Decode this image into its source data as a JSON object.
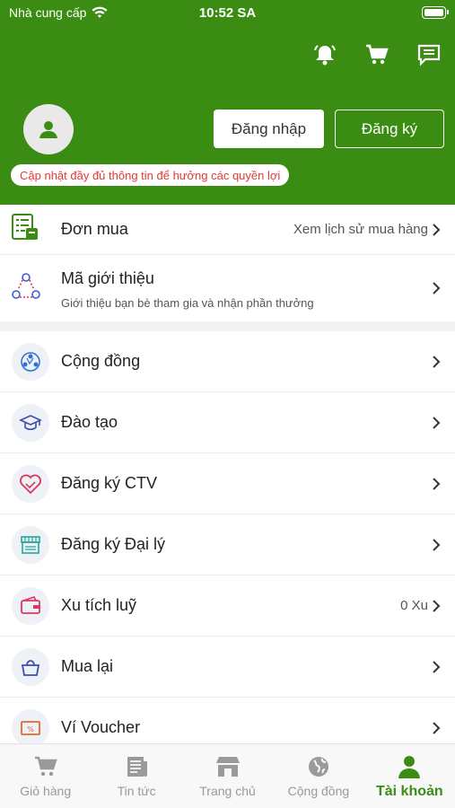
{
  "status_bar": {
    "carrier": "Nhà cung cấp",
    "time": "10:52 SA"
  },
  "header": {
    "login_label": "Đăng nhập",
    "register_label": "Đăng ký",
    "notice": "Cập nhật đầy đủ thông tin để hưởng các quyền lợi",
    "icons": [
      "bell-icon",
      "cart-icon",
      "message-icon"
    ]
  },
  "orders": {
    "label": "Đơn mua",
    "right_text": "Xem lịch sử mua hàng"
  },
  "referral": {
    "label": "Mã giới thiệu",
    "subtitle": "Giới thiệu bạn bè tham gia và nhận phần thưởng"
  },
  "menu": [
    {
      "label": "Cộng đồng",
      "right": "",
      "icon": "community-icon"
    },
    {
      "label": "Đào tạo",
      "right": "",
      "icon": "graduation-cap-icon"
    },
    {
      "label": "Đăng ký CTV",
      "right": "",
      "icon": "handshake-heart-icon"
    },
    {
      "label": "Đăng ký Đại lý",
      "right": "",
      "icon": "store-icon"
    },
    {
      "label": "Xu tích luỹ",
      "right": "0 Xu",
      "icon": "wallet-icon"
    },
    {
      "label": "Mua lại",
      "right": "",
      "icon": "bag-icon"
    },
    {
      "label": "Ví Voucher",
      "right": "",
      "icon": "voucher-icon"
    }
  ],
  "tabbar": [
    {
      "label": "Giỏ hàng",
      "icon": "cart-icon",
      "active": false
    },
    {
      "label": "Tin tức",
      "icon": "news-icon",
      "active": false
    },
    {
      "label": "Trang chủ",
      "icon": "store-icon",
      "active": false
    },
    {
      "label": "Cộng đồng",
      "icon": "globe-icon",
      "active": false
    },
    {
      "label": "Tài khoản",
      "icon": "person-icon",
      "active": true
    }
  ],
  "colors": {
    "brand_green": "#3a8c12",
    "notice_red": "#e8373a"
  }
}
